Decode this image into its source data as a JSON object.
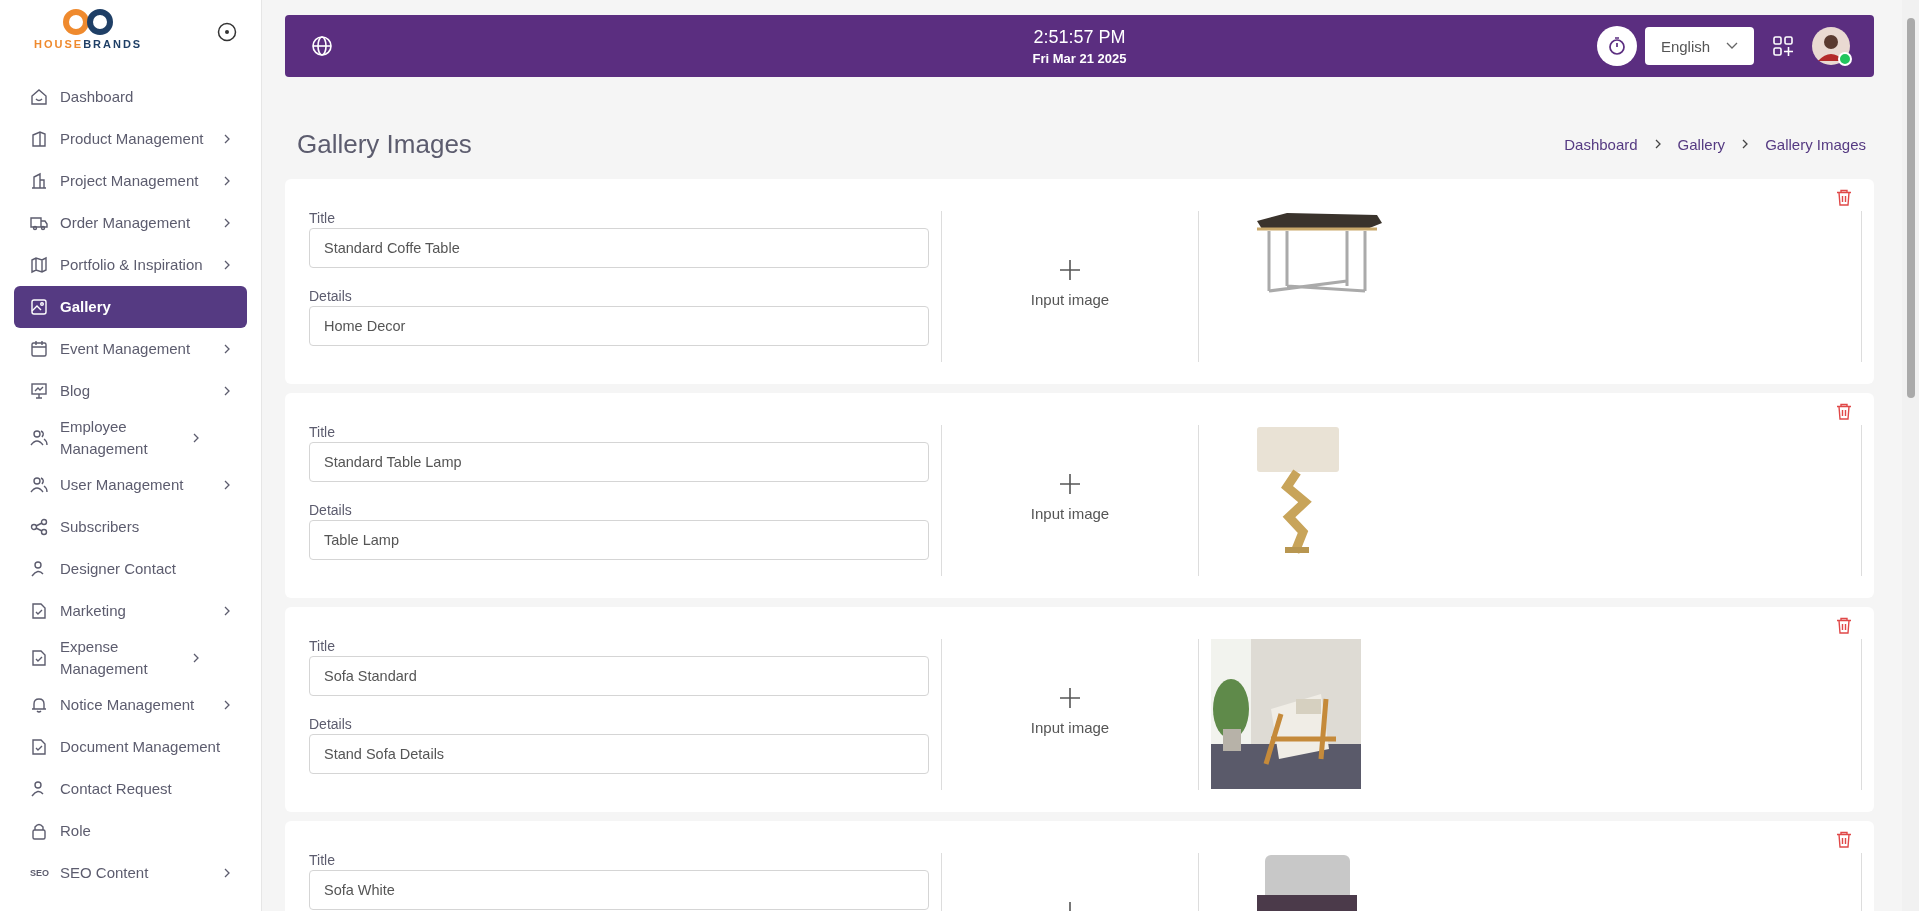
{
  "sidebar": {
    "logo": {
      "part_1": "HOUSE",
      "part_2": "BRANDS"
    },
    "items": [
      {
        "label": "Dashboard",
        "expandable": false,
        "selected": false
      },
      {
        "label": "Product Management",
        "expandable": true,
        "selected": false
      },
      {
        "label": "Project Management",
        "expandable": true,
        "selected": false
      },
      {
        "label": "Order Management",
        "expandable": true,
        "selected": false
      },
      {
        "label": "Portfolio & Inspiration",
        "expandable": true,
        "selected": false
      },
      {
        "label": "Gallery",
        "expandable": false,
        "selected": true
      },
      {
        "label": "Event Management",
        "expandable": true,
        "selected": false
      },
      {
        "label": "Blog",
        "expandable": true,
        "selected": false
      },
      {
        "label": "Employee Management",
        "expandable": true,
        "selected": false
      },
      {
        "label": "User Management",
        "expandable": true,
        "selected": false
      },
      {
        "label": "Subscribers",
        "expandable": false,
        "selected": false
      },
      {
        "label": "Designer Contact",
        "expandable": false,
        "selected": false
      },
      {
        "label": "Marketing",
        "expandable": true,
        "selected": false
      },
      {
        "label": "Expense Management",
        "expandable": true,
        "selected": false
      },
      {
        "label": "Notice Management",
        "expandable": true,
        "selected": false
      },
      {
        "label": "Document Management",
        "expandable": false,
        "selected": false
      },
      {
        "label": "Contact Request",
        "expandable": false,
        "selected": false
      },
      {
        "label": "Role",
        "expandable": false,
        "selected": false
      },
      {
        "label": "SEO Content",
        "expandable": true,
        "selected": false,
        "icon_text": "SEO"
      }
    ]
  },
  "header": {
    "time": "2:51:57 PM",
    "date": "Fri Mar 21 2025",
    "language": "English",
    "user_online": true
  },
  "page": {
    "title": "Gallery Images",
    "breadcrumb": [
      "Dashboard",
      "Gallery",
      "Gallery Images"
    ]
  },
  "gallery_items": [
    {
      "title_label": "Title",
      "title": "Standard Coffe Table",
      "details_label": "Details",
      "details": "Home Decor",
      "upload_label": "Input image"
    },
    {
      "title_label": "Title",
      "title": "Standard Table Lamp",
      "details_label": "Details",
      "details": "Table Lamp",
      "upload_label": "Input image"
    },
    {
      "title_label": "Title",
      "title": "Sofa Standard",
      "details_label": "Details",
      "details": "Stand Sofa Details",
      "upload_label": "Input image"
    },
    {
      "title_label": "Title",
      "title": "Sofa White"
    }
  ]
}
